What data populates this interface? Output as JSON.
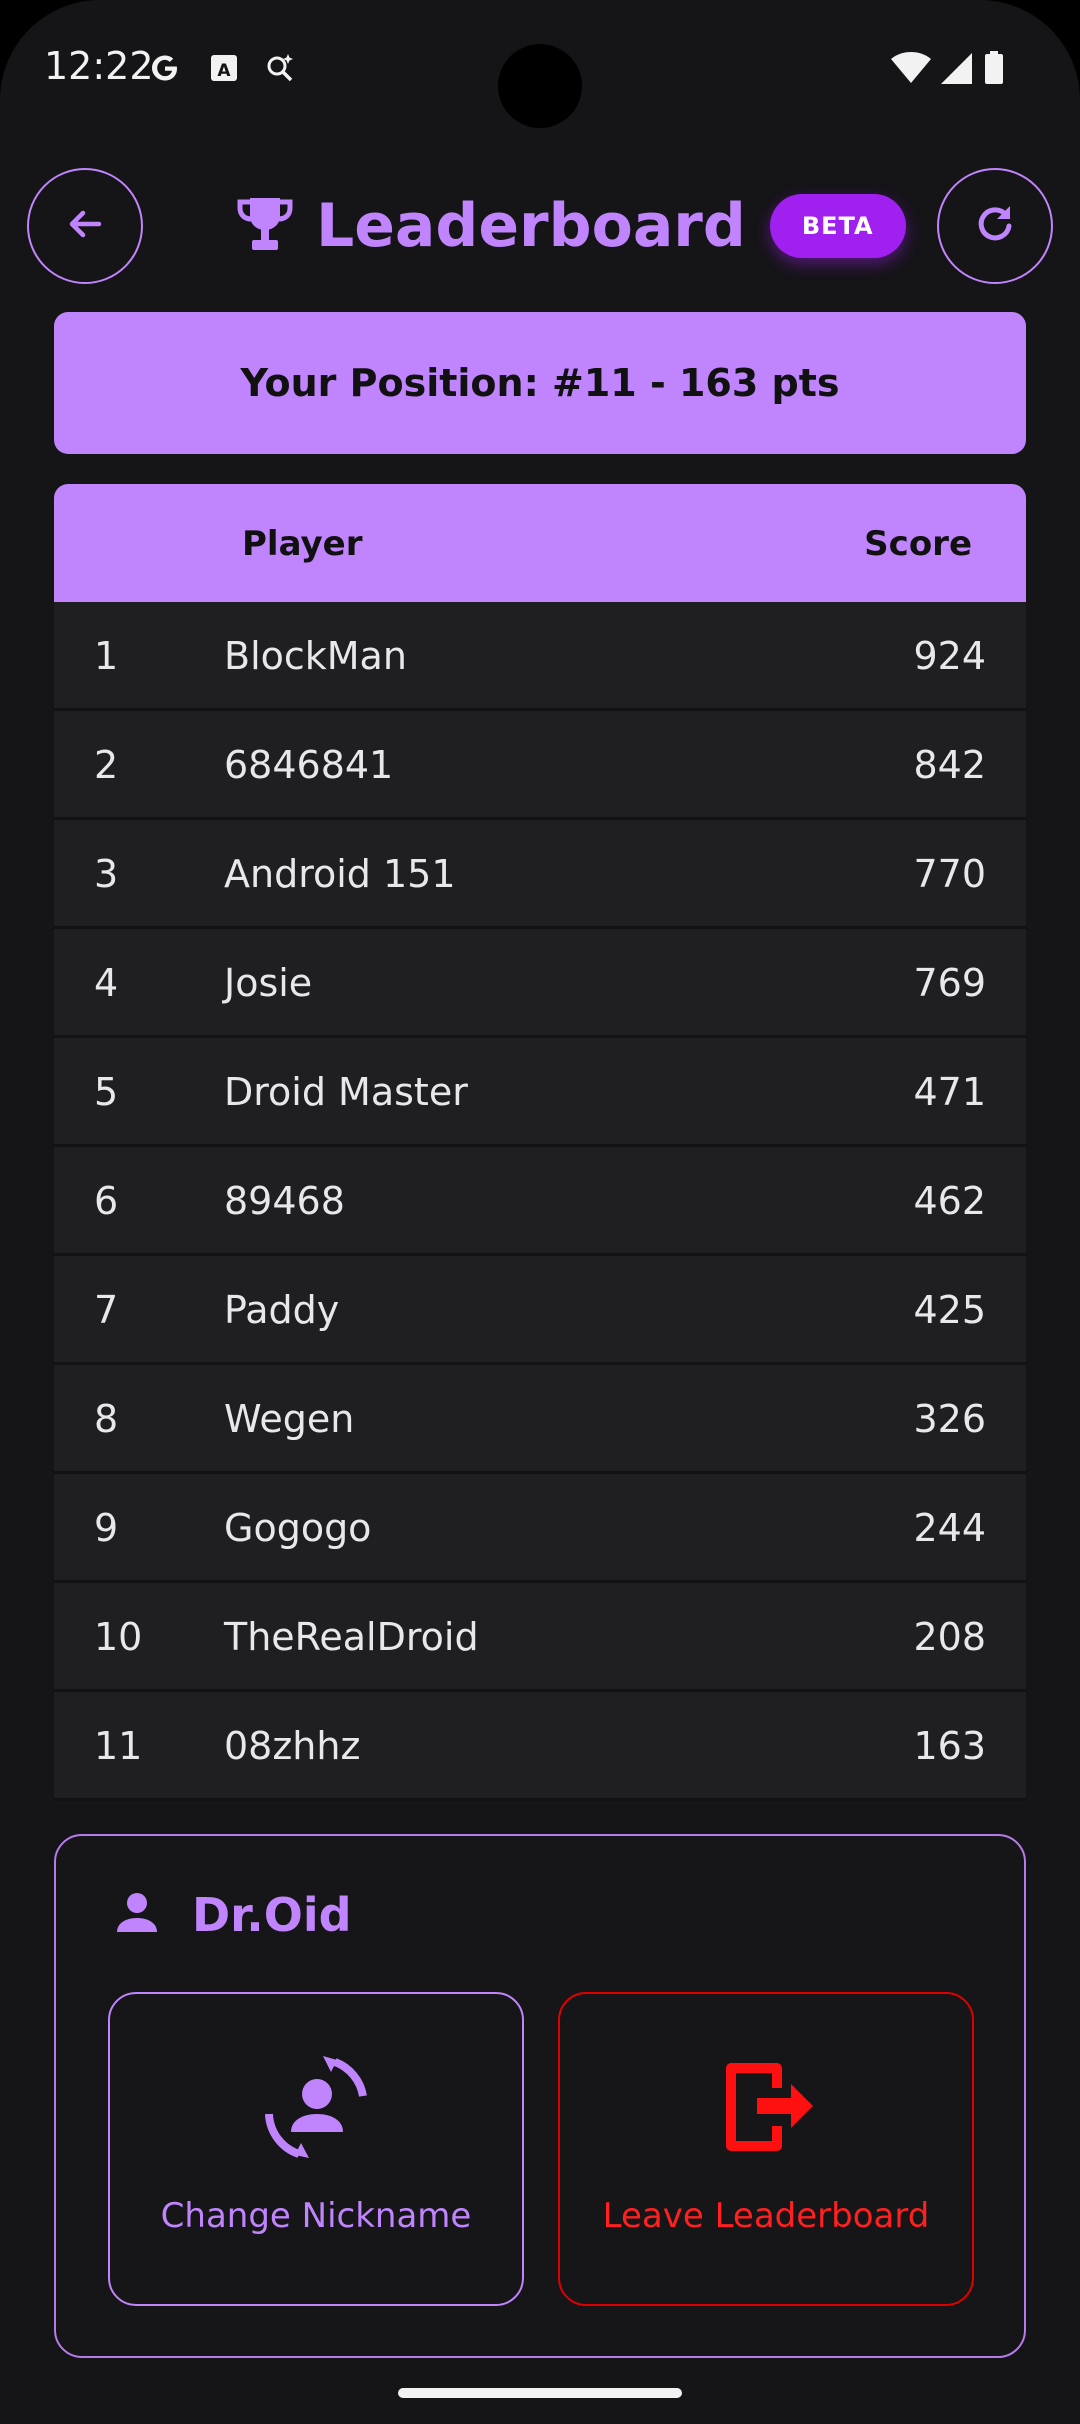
{
  "status_bar": {
    "time": "12:22",
    "left_icons": [
      "google-icon",
      "translate-icon",
      "assistant-sparkle-icon"
    ],
    "right_icons": [
      "wifi-icon",
      "signal-icon",
      "battery-icon"
    ]
  },
  "header": {
    "title": "Leaderboard",
    "badge": "BETA",
    "back_icon": "arrow-left-icon",
    "title_icon": "trophy-icon",
    "refresh_icon": "refresh-icon"
  },
  "position_banner": "Your Position: #11 - 163 pts",
  "table": {
    "columns": {
      "player": "Player",
      "score": "Score"
    },
    "rows": [
      {
        "rank": "1",
        "name": "BlockMan",
        "score": "924"
      },
      {
        "rank": "2",
        "name": "6846841",
        "score": "842"
      },
      {
        "rank": "3",
        "name": "Android 151",
        "score": "770"
      },
      {
        "rank": "4",
        "name": "Josie",
        "score": "769"
      },
      {
        "rank": "5",
        "name": "Droid Master",
        "score": "471"
      },
      {
        "rank": "6",
        "name": "89468",
        "score": "462"
      },
      {
        "rank": "7",
        "name": "Paddy",
        "score": "425"
      },
      {
        "rank": "8",
        "name": "Wegen",
        "score": "326"
      },
      {
        "rank": "9",
        "name": "Gogogo",
        "score": "244"
      },
      {
        "rank": "10",
        "name": "TheRealDroid",
        "score": "208"
      },
      {
        "rank": "11",
        "name": "08zhhz",
        "score": "163"
      }
    ]
  },
  "profile": {
    "username": "Dr.Oid",
    "user_icon": "person-icon",
    "change_nickname_label": "Change Nickname",
    "change_nickname_icon": "person-sync-icon",
    "leave_label": "Leave Leaderboard",
    "leave_icon": "exit-icon"
  },
  "colors": {
    "accent": "#c084fc",
    "badge": "#a020f0",
    "danger": "#e00000",
    "background": "#151417",
    "row": "#1f1e21"
  }
}
